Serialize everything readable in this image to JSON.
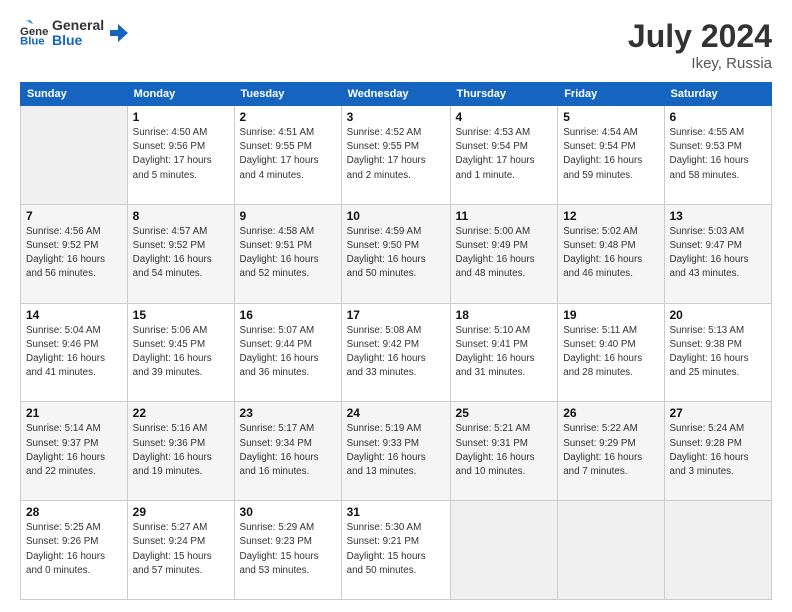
{
  "header": {
    "logo_general": "General",
    "logo_blue": "Blue",
    "month": "July 2024",
    "location": "Ikey, Russia"
  },
  "columns": [
    "Sunday",
    "Monday",
    "Tuesday",
    "Wednesday",
    "Thursday",
    "Friday",
    "Saturday"
  ],
  "weeks": [
    [
      {
        "day": "",
        "info": ""
      },
      {
        "day": "1",
        "info": "Sunrise: 4:50 AM\nSunset: 9:56 PM\nDaylight: 17 hours\nand 5 minutes."
      },
      {
        "day": "2",
        "info": "Sunrise: 4:51 AM\nSunset: 9:55 PM\nDaylight: 17 hours\nand 4 minutes."
      },
      {
        "day": "3",
        "info": "Sunrise: 4:52 AM\nSunset: 9:55 PM\nDaylight: 17 hours\nand 2 minutes."
      },
      {
        "day": "4",
        "info": "Sunrise: 4:53 AM\nSunset: 9:54 PM\nDaylight: 17 hours\nand 1 minute."
      },
      {
        "day": "5",
        "info": "Sunrise: 4:54 AM\nSunset: 9:54 PM\nDaylight: 16 hours\nand 59 minutes."
      },
      {
        "day": "6",
        "info": "Sunrise: 4:55 AM\nSunset: 9:53 PM\nDaylight: 16 hours\nand 58 minutes."
      }
    ],
    [
      {
        "day": "7",
        "info": "Sunrise: 4:56 AM\nSunset: 9:52 PM\nDaylight: 16 hours\nand 56 minutes."
      },
      {
        "day": "8",
        "info": "Sunrise: 4:57 AM\nSunset: 9:52 PM\nDaylight: 16 hours\nand 54 minutes."
      },
      {
        "day": "9",
        "info": "Sunrise: 4:58 AM\nSunset: 9:51 PM\nDaylight: 16 hours\nand 52 minutes."
      },
      {
        "day": "10",
        "info": "Sunrise: 4:59 AM\nSunset: 9:50 PM\nDaylight: 16 hours\nand 50 minutes."
      },
      {
        "day": "11",
        "info": "Sunrise: 5:00 AM\nSunset: 9:49 PM\nDaylight: 16 hours\nand 48 minutes."
      },
      {
        "day": "12",
        "info": "Sunrise: 5:02 AM\nSunset: 9:48 PM\nDaylight: 16 hours\nand 46 minutes."
      },
      {
        "day": "13",
        "info": "Sunrise: 5:03 AM\nSunset: 9:47 PM\nDaylight: 16 hours\nand 43 minutes."
      }
    ],
    [
      {
        "day": "14",
        "info": "Sunrise: 5:04 AM\nSunset: 9:46 PM\nDaylight: 16 hours\nand 41 minutes."
      },
      {
        "day": "15",
        "info": "Sunrise: 5:06 AM\nSunset: 9:45 PM\nDaylight: 16 hours\nand 39 minutes."
      },
      {
        "day": "16",
        "info": "Sunrise: 5:07 AM\nSunset: 9:44 PM\nDaylight: 16 hours\nand 36 minutes."
      },
      {
        "day": "17",
        "info": "Sunrise: 5:08 AM\nSunset: 9:42 PM\nDaylight: 16 hours\nand 33 minutes."
      },
      {
        "day": "18",
        "info": "Sunrise: 5:10 AM\nSunset: 9:41 PM\nDaylight: 16 hours\nand 31 minutes."
      },
      {
        "day": "19",
        "info": "Sunrise: 5:11 AM\nSunset: 9:40 PM\nDaylight: 16 hours\nand 28 minutes."
      },
      {
        "day": "20",
        "info": "Sunrise: 5:13 AM\nSunset: 9:38 PM\nDaylight: 16 hours\nand 25 minutes."
      }
    ],
    [
      {
        "day": "21",
        "info": "Sunrise: 5:14 AM\nSunset: 9:37 PM\nDaylight: 16 hours\nand 22 minutes."
      },
      {
        "day": "22",
        "info": "Sunrise: 5:16 AM\nSunset: 9:36 PM\nDaylight: 16 hours\nand 19 minutes."
      },
      {
        "day": "23",
        "info": "Sunrise: 5:17 AM\nSunset: 9:34 PM\nDaylight: 16 hours\nand 16 minutes."
      },
      {
        "day": "24",
        "info": "Sunrise: 5:19 AM\nSunset: 9:33 PM\nDaylight: 16 hours\nand 13 minutes."
      },
      {
        "day": "25",
        "info": "Sunrise: 5:21 AM\nSunset: 9:31 PM\nDaylight: 16 hours\nand 10 minutes."
      },
      {
        "day": "26",
        "info": "Sunrise: 5:22 AM\nSunset: 9:29 PM\nDaylight: 16 hours\nand 7 minutes."
      },
      {
        "day": "27",
        "info": "Sunrise: 5:24 AM\nSunset: 9:28 PM\nDaylight: 16 hours\nand 3 minutes."
      }
    ],
    [
      {
        "day": "28",
        "info": "Sunrise: 5:25 AM\nSunset: 9:26 PM\nDaylight: 16 hours\nand 0 minutes."
      },
      {
        "day": "29",
        "info": "Sunrise: 5:27 AM\nSunset: 9:24 PM\nDaylight: 15 hours\nand 57 minutes."
      },
      {
        "day": "30",
        "info": "Sunrise: 5:29 AM\nSunset: 9:23 PM\nDaylight: 15 hours\nand 53 minutes."
      },
      {
        "day": "31",
        "info": "Sunrise: 5:30 AM\nSunset: 9:21 PM\nDaylight: 15 hours\nand 50 minutes."
      },
      {
        "day": "",
        "info": ""
      },
      {
        "day": "",
        "info": ""
      },
      {
        "day": "",
        "info": ""
      }
    ]
  ]
}
